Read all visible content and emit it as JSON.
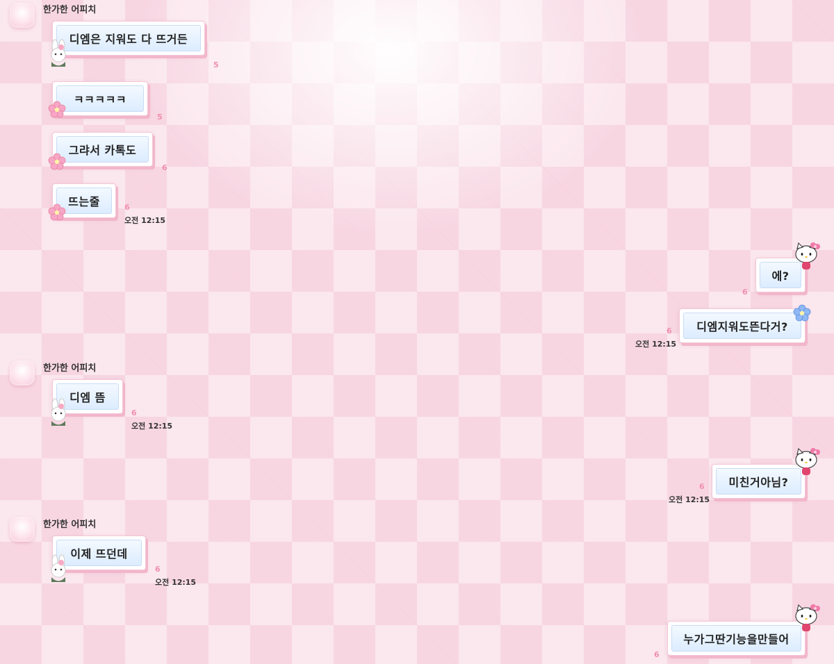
{
  "colors": {
    "unread": "#f08fb0",
    "bubble_fill": "#dcecff",
    "bubble_border": "#f2b6cb"
  },
  "messages": [
    {
      "side": "left",
      "sender": "한가한 어피치",
      "text": "디엠은 지워도 다 뜨거든",
      "unread": "5",
      "deco": "bunny-sticker"
    },
    {
      "side": "left",
      "text": "ㅋㅋㅋㅋㅋ",
      "unread": "5",
      "deco": "pink-flower"
    },
    {
      "side": "left",
      "text": "그랴서 카톡도",
      "unread": "6",
      "deco": "pink-flower"
    },
    {
      "side": "left",
      "text": "뜨는줄",
      "unread": "6",
      "time": "오전 12:15",
      "deco": "pink-flower"
    },
    {
      "side": "right",
      "text": "에?",
      "unread": "6",
      "deco": "hello-kitty-sticker"
    },
    {
      "side": "right",
      "text": "디엠지워도뜬다거?",
      "unread": "6",
      "time": "오전 12:15",
      "deco": "blue-flower"
    },
    {
      "side": "left",
      "sender": "한가한 어피치",
      "text": "디엠 뜸",
      "unread": "6",
      "time": "오전 12:15",
      "deco": "bunny-sticker"
    },
    {
      "side": "right",
      "text": "미친거아님?",
      "unread": "6",
      "time": "오전 12:15",
      "deco": "hello-kitty-sticker"
    },
    {
      "side": "left",
      "sender": "한가한 어피치",
      "text": "이제 뜨던데",
      "unread": "6",
      "time": "오전 12:15",
      "deco": "bunny-sticker"
    },
    {
      "side": "right",
      "text": "누가그딴기능을만들어",
      "unread": "6",
      "deco": "hello-kitty-sticker"
    }
  ]
}
